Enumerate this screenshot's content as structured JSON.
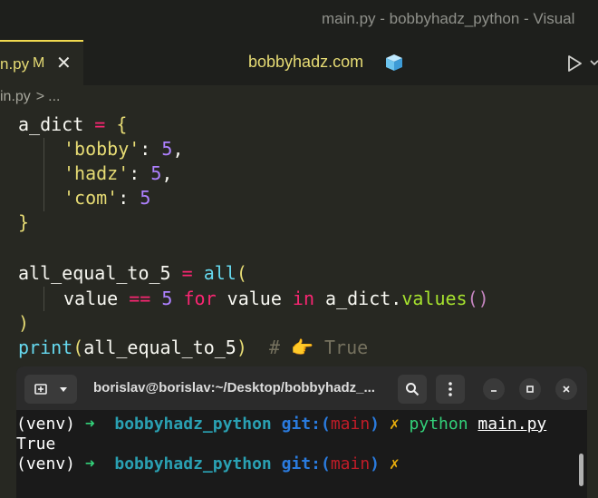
{
  "window": {
    "title": "main.py - bobbyhadz_python - Visual"
  },
  "tabs": {
    "active_label": "n.py",
    "modified_flag": "M",
    "center_label": "bobbyhadz.com"
  },
  "breadcrumb": {
    "file": "in.py",
    "separator": ">",
    "more": "..."
  },
  "code": {
    "l1": {
      "var": "a_dict",
      "op": " = ",
      "brace": "{"
    },
    "l2": {
      "key": "'bobby'",
      "colon": ": ",
      "val": "5",
      "comma": ","
    },
    "l3": {
      "key": "'hadz'",
      "colon": ": ",
      "val": "5",
      "comma": ","
    },
    "l4": {
      "key": "'com'",
      "colon": ": ",
      "val": "5"
    },
    "l5": {
      "brace": "}"
    },
    "l7": {
      "var": "all_equal_to_5",
      "op": " = ",
      "fn": "all",
      "paren": "("
    },
    "l8": {
      "w1": "value ",
      "op": "==",
      "sp1": " ",
      "num": "5",
      "sp2": " ",
      "kw_for": "for",
      "w2": " value ",
      "kw_in": "in",
      "w3": " a_dict.",
      "method": "values",
      "parens": "()"
    },
    "l9": {
      "paren": ")"
    },
    "l10": {
      "fn": "print",
      "open": "(",
      "arg": "all_equal_to_5",
      "close": ")",
      "comment_hash": "  # ",
      "emoji": "👉",
      "comment_text": " True"
    }
  },
  "terminal": {
    "title": "borislav@borislav:~/Desktop/bobbyhadz_...",
    "lines": [
      {
        "venv": "(venv) ",
        "arrow": "➜",
        "dir": "  bobbyhadz_python ",
        "git": "git:",
        "p_open": "(",
        "branch": "main",
        "p_close": ")",
        "x": " ✗",
        "cmd": " python ",
        "file": "main.py"
      },
      {
        "text": "True"
      },
      {
        "venv": "(venv) ",
        "arrow": "➜",
        "dir": "  bobbyhadz_python ",
        "git": "git:",
        "p_open": "(",
        "branch": "main",
        "p_close": ")",
        "x": " ✗"
      }
    ]
  },
  "icons": {
    "tab_close": "close-icon",
    "cube": "cube-icon",
    "run": "play-icon",
    "run_menu": "chevron-down-icon",
    "new_tab": "new-terminal-tab-icon",
    "menu": "chevron-down-icon",
    "search": "search-icon",
    "kebab": "more-vertical-icon",
    "minimize": "minimize-icon",
    "maximize": "maximize-icon",
    "close": "close-icon"
  },
  "colors": {
    "editor_bg": "#272822",
    "accent_tab_border": "#f0d94f",
    "string": "#e6db74",
    "number": "#ae81ff",
    "keyword": "#f92672",
    "builtin": "#66d9ef",
    "terminal_bg": "#1a1a1a"
  }
}
